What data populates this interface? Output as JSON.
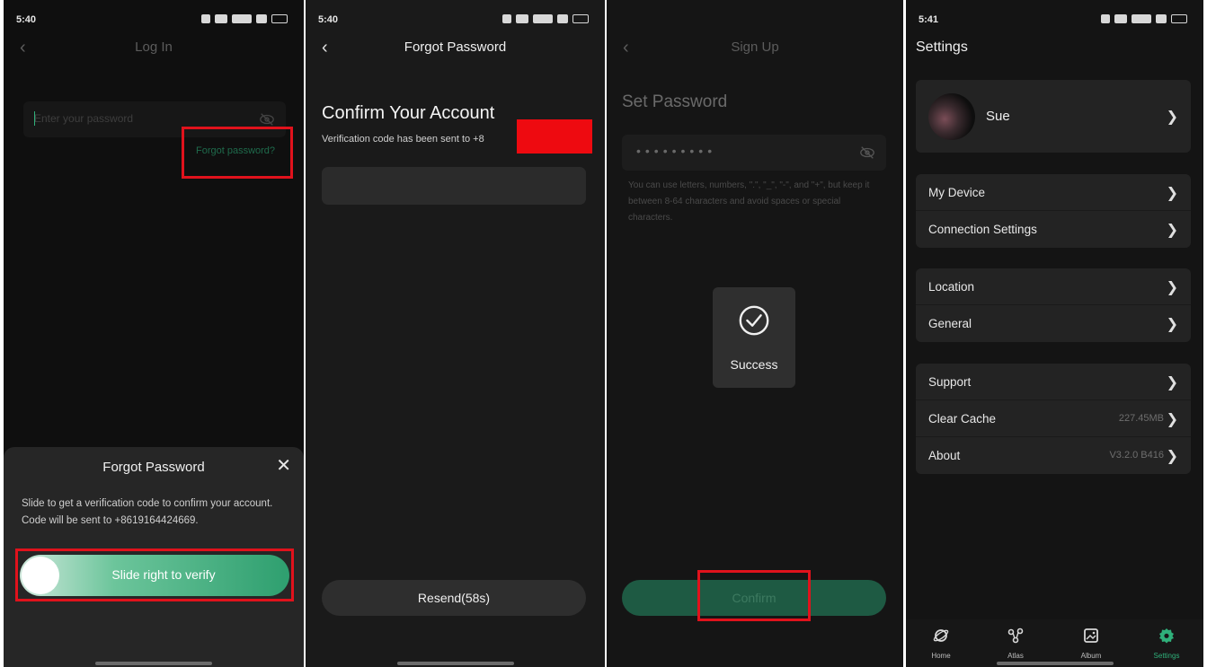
{
  "colors": {
    "accent": "#2fb07a",
    "highlight_box": "#e0121c",
    "redaction": "#ee0a10"
  },
  "panel_login": {
    "time": "5:40",
    "title": "Log In",
    "password_placeholder": "Enter your password",
    "forgot_link": "Forgot password?",
    "sheet": {
      "title": "Forgot Password",
      "body": "Slide to get a verification code to confirm your account. Code will be sent to +8619164424669.",
      "slider_label": "Slide right to verify"
    }
  },
  "panel_forgot": {
    "time": "5:40",
    "title": "Forgot Password",
    "heading": "Confirm Your Account",
    "subline": "Verification code has been sent to +8",
    "resend_label": "Resend(58s)"
  },
  "panel_signup": {
    "title": "Sign Up",
    "heading": "Set Password",
    "password_mask": "•••••••••",
    "hint": "You can use letters, numbers, \".\", \"_\", \"-\", and \"+\", but keep it between 8-64 characters and avoid spaces or special characters.",
    "toast_label": "Success",
    "confirm_label": "Confirm"
  },
  "panel_settings": {
    "time": "5:41",
    "title": "Settings",
    "username": "Sue",
    "group1": [
      {
        "label": "My Device"
      },
      {
        "label": "Connection Settings"
      }
    ],
    "group2": [
      {
        "label": "Location"
      },
      {
        "label": "General"
      }
    ],
    "group3": [
      {
        "label": "Support",
        "value": ""
      },
      {
        "label": "Clear Cache",
        "value": "227.45MB"
      },
      {
        "label": "About",
        "value": "V3.2.0 B416"
      }
    ],
    "tabs": [
      {
        "label": "Home",
        "icon": "planet-icon"
      },
      {
        "label": "Atlas",
        "icon": "nodes-icon"
      },
      {
        "label": "Album",
        "icon": "image-icon"
      },
      {
        "label": "Settings",
        "icon": "gear-icon"
      }
    ]
  }
}
